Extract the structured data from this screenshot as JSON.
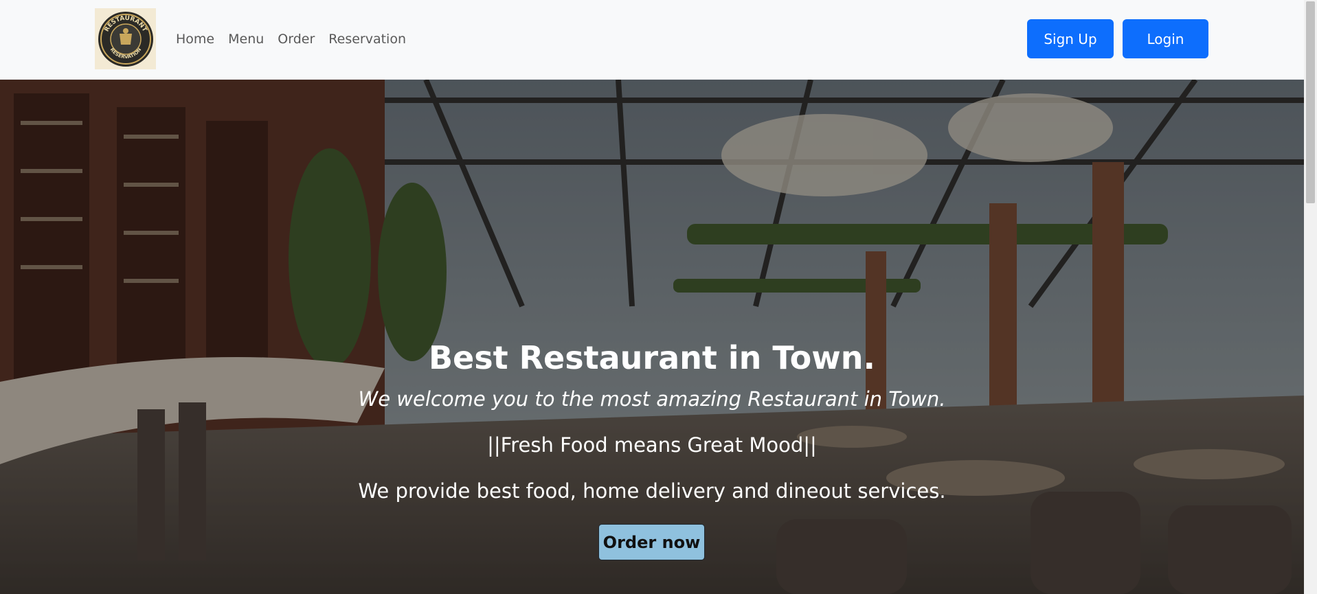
{
  "navbar": {
    "logo": {
      "top_text": "RESTAURANT",
      "bottom_text": "RESERVATION",
      "icon": "restaurant-emblem-icon"
    },
    "links": [
      {
        "label": "Home"
      },
      {
        "label": "Menu"
      },
      {
        "label": "Order"
      },
      {
        "label": "Reservation"
      }
    ],
    "signup_label": "Sign Up",
    "login_label": "Login"
  },
  "hero": {
    "title": "Best Restaurant in Town.",
    "welcome": "We welcome you to the most amazing Restaurant in Town.",
    "motto": "||Fresh Food means Great Mood||",
    "services": "We provide best food, home delivery and dineout services.",
    "order_button": "Order now"
  },
  "colors": {
    "primary_button": "#0d6efd",
    "order_button": "#8fc1de",
    "navbar_bg": "#f8f9fa"
  }
}
